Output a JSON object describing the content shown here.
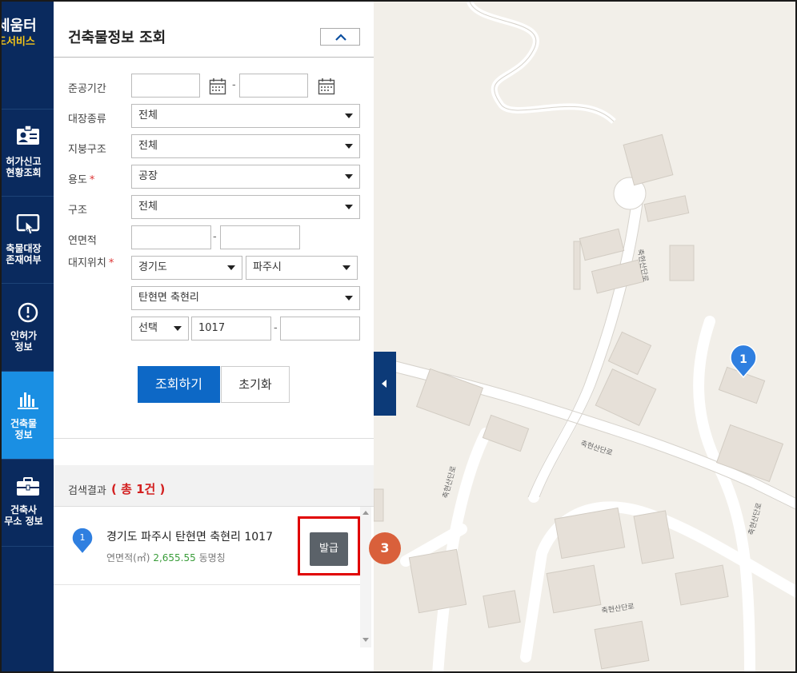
{
  "sidebar": {
    "brand_line1": "세움터",
    "brand_line2": "도서비스",
    "items": [
      {
        "line1": "허가신고",
        "line2": "현황조회",
        "icon": "id-card-icon",
        "active": false
      },
      {
        "line1": "축물대장",
        "line2": "존재여부",
        "icon": "touch-screen-icon",
        "active": false
      },
      {
        "line1": "인허가",
        "line2": "정보",
        "icon": "clock-icon",
        "active": false
      },
      {
        "line1": "건축물",
        "line2": "정보",
        "icon": "bar-chart-icon",
        "active": true
      },
      {
        "line1": "건축사",
        "line2": "무소 정보",
        "icon": "briefcase-icon",
        "active": false
      }
    ]
  },
  "panel": {
    "title": "건축물정보 조회",
    "collapse_icon": "chevron-up-icon"
  },
  "form": {
    "completion_period_label": "준공기간",
    "completion_from": "",
    "completion_to": "",
    "register_type_label": "대장종류",
    "register_type_value": "전체",
    "roof_structure_label": "지붕구조",
    "roof_structure_value": "전체",
    "usage_label": "용도",
    "usage_value": "공장",
    "structure_label": "구조",
    "structure_value": "전체",
    "floor_area_label": "연면적",
    "floor_area_from": "",
    "floor_area_to": "",
    "location_label": "대지위치",
    "province_value": "경기도",
    "city_value": "파주시",
    "town_value": "탄현면 축현리",
    "lot_type_value": "선택",
    "lot_main": "1017",
    "lot_sub": "",
    "required_mark": "*",
    "range_dash": "-"
  },
  "buttons": {
    "search": "조회하기",
    "reset": "초기화"
  },
  "results": {
    "label": "검색결과",
    "count_text": "( 총 1건 )",
    "items": [
      {
        "marker": "1",
        "address": "경기도 파주시 탄현면 축현리 1017",
        "area_label": "연면적(㎡)",
        "area_value": "2,655.55",
        "building_name_label": "동명칭",
        "issue_button": "발급"
      }
    ]
  },
  "map": {
    "marker_label": "1",
    "road_labels": [
      "축현산단로",
      "축현산단로",
      "축현산단로",
      "축현산단로",
      "축현산단로"
    ]
  },
  "step_badge": "3",
  "colors": {
    "sidebar_bg": "#0a2a5e",
    "sidebar_active": "#1a8fe3",
    "primary_button": "#0d68c6",
    "result_count": "#d32020",
    "area_value": "#3a9d3a",
    "highlight_box": "#e00000",
    "step_badge": "#d9603b",
    "map_marker": "#2f7fe0"
  }
}
